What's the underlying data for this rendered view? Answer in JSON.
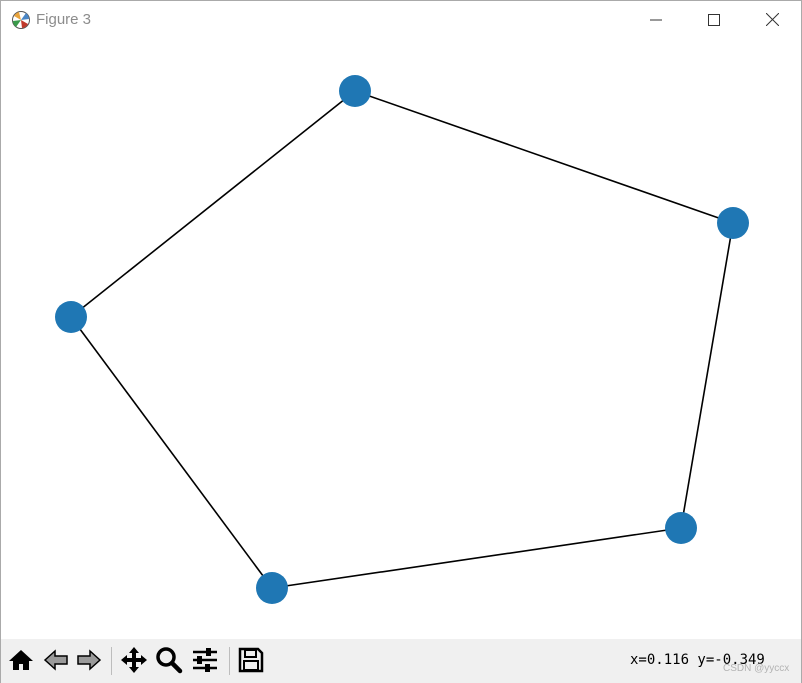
{
  "window": {
    "title": "Figure 3",
    "icons": {
      "app": "matplotlib-figure-icon",
      "minimize": "minimize-icon",
      "maximize": "maximize-icon",
      "close": "close-icon"
    }
  },
  "graph": {
    "node_color": "#1f77b4",
    "edge_color": "#000000",
    "nodes": [
      "n0",
      "n1",
      "n2",
      "n3",
      "n4"
    ],
    "edges": [
      [
        "n0",
        "n1"
      ],
      [
        "n1",
        "n2"
      ],
      [
        "n2",
        "n3"
      ],
      [
        "n3",
        "n4"
      ],
      [
        "n4",
        "n0"
      ]
    ]
  },
  "toolbar": {
    "tools": [
      {
        "name": "home-icon"
      },
      {
        "name": "back-arrow-icon"
      },
      {
        "name": "forward-arrow-icon"
      },
      {
        "name": "pan-icon"
      },
      {
        "name": "zoom-icon"
      },
      {
        "name": "configure-subplots-icon"
      },
      {
        "name": "save-icon"
      }
    ],
    "coords_text": "x=0.116 y=-0.349",
    "watermark": "CSDN @yyccx"
  }
}
